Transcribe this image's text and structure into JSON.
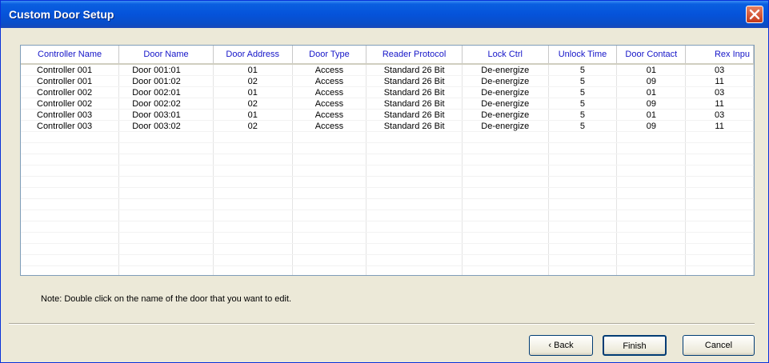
{
  "window": {
    "title": "Custom Door Setup"
  },
  "table": {
    "columns": [
      "Controller Name",
      "Door Name",
      "Door Address",
      "Door Type",
      "Reader Protocol",
      "Lock Ctrl",
      "Unlock Time",
      "Door Contact",
      "Rex Inpu"
    ],
    "rows": [
      [
        "Controller 001",
        "Door 001:01",
        "01",
        "Access",
        "Standard 26 Bit",
        "De-energize",
        "5",
        "01",
        "03"
      ],
      [
        "Controller 001",
        "Door 001:02",
        "02",
        "Access",
        "Standard 26 Bit",
        "De-energize",
        "5",
        "09",
        "11"
      ],
      [
        "Controller 002",
        "Door 002:01",
        "01",
        "Access",
        "Standard 26 Bit",
        "De-energize",
        "5",
        "01",
        "03"
      ],
      [
        "Controller 002",
        "Door 002:02",
        "02",
        "Access",
        "Standard 26 Bit",
        "De-energize",
        "5",
        "09",
        "11"
      ],
      [
        "Controller 003",
        "Door 003:01",
        "01",
        "Access",
        "Standard 26 Bit",
        "De-energize",
        "5",
        "01",
        "03"
      ],
      [
        "Controller 003",
        "Door 003:02",
        "02",
        "Access",
        "Standard 26 Bit",
        "De-energize",
        "5",
        "09",
        "11"
      ]
    ]
  },
  "note": "Note: Double click on the name of the door that you want to edit.",
  "buttons": {
    "back": "‹ Back",
    "finish": "Finish",
    "cancel": "Cancel"
  },
  "icons": {
    "close": "close-icon"
  },
  "colors": {
    "header_text": "#1515c8",
    "titlebar": "#0553da",
    "window_bg": "#ece9d8"
  }
}
